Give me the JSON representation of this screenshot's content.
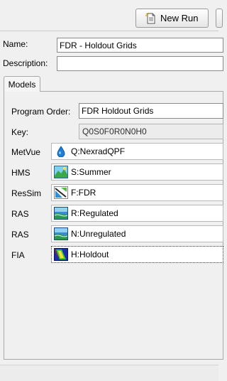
{
  "toolbar": {
    "new_run_label": "New Run"
  },
  "form": {
    "name_label": "Name:",
    "name_value": "FDR - Holdout Grids",
    "description_label": "Description:",
    "description_value": ""
  },
  "tabs": [
    {
      "label": "Models"
    }
  ],
  "models_tab": {
    "program_order_label": "Program Order:",
    "program_order_value": "FDR Holdout Grids",
    "key_label": "Key:",
    "key_value": "Q0S0F0R0N0H0",
    "rows": [
      {
        "program": "MetVue",
        "value": "Q:NexradQPF",
        "icon": "water-drop-icon"
      },
      {
        "program": "HMS",
        "value": "S:Summer",
        "icon": "hms-landscape-icon"
      },
      {
        "program": "ResSim",
        "value": "F:FDR",
        "icon": "ressim-reservoir-icon"
      },
      {
        "program": "RAS",
        "value": "R:Regulated",
        "icon": "ras-river-icon"
      },
      {
        "program": "RAS",
        "value": "N:Unregulated",
        "icon": "ras-river-icon"
      },
      {
        "program": "FIA",
        "value": "H:Holdout",
        "icon": "fia-map-icon"
      }
    ]
  }
}
